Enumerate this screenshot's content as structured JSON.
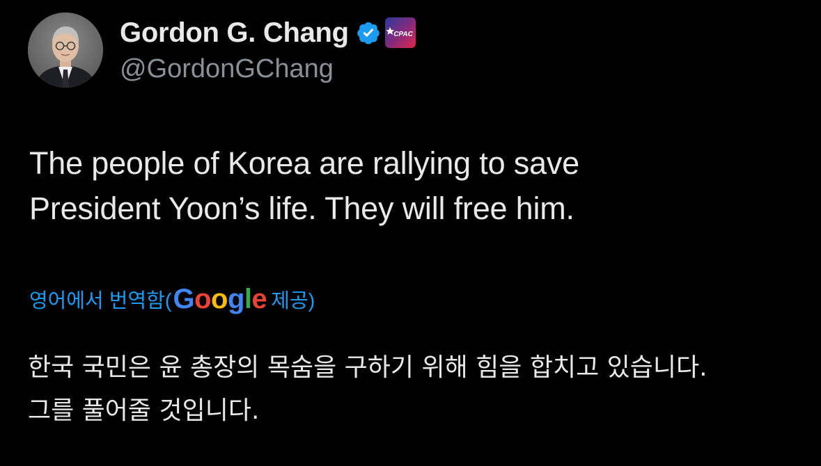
{
  "author": {
    "display_name": "Gordon G. Chang",
    "handle": "@GordonGChang",
    "verified_icon": "verified-badge-icon",
    "affiliate_badge": "cpac-badge-icon",
    "affiliate_badge_text": "CPAC"
  },
  "tweet": {
    "lines": [
      "The people of Korea are rallying to save",
      "President Yoon’s life. They will free him."
    ]
  },
  "translation": {
    "prefix": "영어에서 번역함(",
    "provider_letters": [
      "G",
      "o",
      "o",
      "g",
      "l",
      "e"
    ],
    "suffix": " 제공)",
    "lines": [
      "한국 국민은 윤 총장의 목숨을 구하기 위해 힘을 합치고 있습니다.",
      "그를 풀어줄 것입니다."
    ]
  },
  "colors": {
    "background": "#000000",
    "text": "#e7e9ea",
    "secondary": "#8b9096",
    "link": "#1d9bf0",
    "verified": "#1d9bf0"
  }
}
